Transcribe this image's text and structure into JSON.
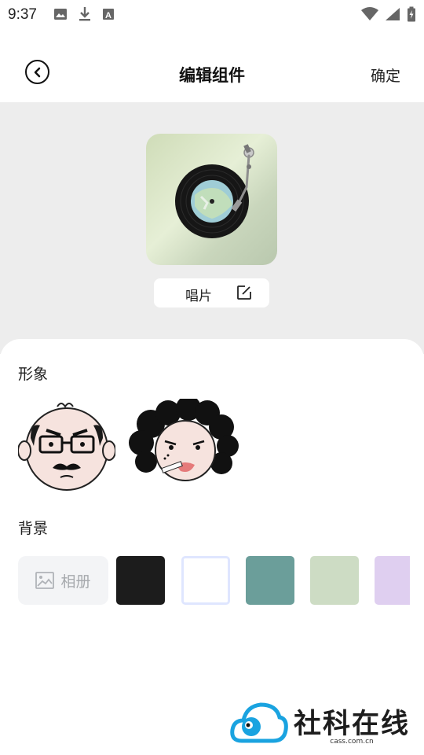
{
  "status_bar": {
    "time": "9:37",
    "icons_left": [
      "image-icon",
      "download-icon",
      "a-box-icon"
    ],
    "icons_right": [
      "wifi-icon",
      "signal-icon",
      "battery-icon"
    ]
  },
  "header": {
    "title": "编辑组件",
    "confirm_label": "确定",
    "back_icon": "back-arrow-icon"
  },
  "preview": {
    "widget_type": "vinyl-record",
    "label": "唱片",
    "edit_icon": "edit-icon"
  },
  "figure": {
    "title": "形象",
    "avatars": [
      {
        "name": "bald-glasses-man"
      },
      {
        "name": "curly-hair-woman-cigarette"
      }
    ]
  },
  "background": {
    "title": "背景",
    "album_label": "相册",
    "swatches": [
      "#1c1c1c",
      "#ffffff",
      "#6b9e9a",
      "#cddcc4",
      "#dfcff0"
    ]
  },
  "watermark": {
    "text": "社科在线",
    "sub": "cass.com.cn"
  }
}
